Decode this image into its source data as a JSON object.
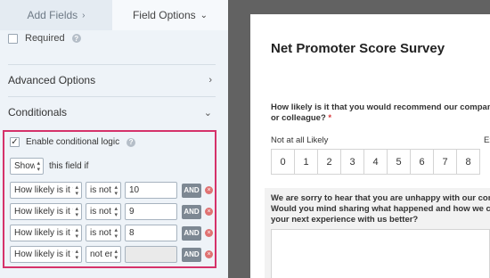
{
  "tabs": {
    "add_fields": "Add Fields",
    "add_fields_chevron": "›",
    "field_options": "Field Options",
    "field_options_chevron": "⌄"
  },
  "required": {
    "label": "Required",
    "checked": false,
    "help_icon": "question-icon"
  },
  "sections": {
    "advanced": {
      "label": "Advanced Options",
      "arrow": "›"
    },
    "conditionals": {
      "label": "Conditionals",
      "arrow": "⌄"
    }
  },
  "conditional": {
    "enable_label": "Enable conditional logic",
    "enabled": true,
    "checkmark": "✓",
    "action": "Show",
    "action_suffix": "this field if",
    "rules": [
      {
        "field": "How likely is it th",
        "operator": "is not",
        "value": "10",
        "and": "AND",
        "delete": "×"
      },
      {
        "field": "How likely is it th",
        "operator": "is not",
        "value": "9",
        "and": "AND",
        "delete": "×"
      },
      {
        "field": "How likely is it th",
        "operator": "is not",
        "value": "8",
        "and": "AND",
        "delete": "×"
      },
      {
        "field": "How likely is it th",
        "operator": "not em",
        "value": "",
        "and": "AND",
        "delete": "×"
      }
    ]
  },
  "preview": {
    "title": "Net Promoter Score Survey",
    "question1_line1": "How likely is it that you would recommend our company",
    "question1_line2": "or colleague?",
    "required_mark": "*",
    "scale_low": "Not at all Likely",
    "scale_high": "Ex",
    "scale": [
      "0",
      "1",
      "2",
      "3",
      "4",
      "5",
      "6",
      "7",
      "8"
    ],
    "question2_line1": "We are sorry to hear that you are unhappy with our com",
    "question2_line2": "Would you mind sharing what happened and how we co",
    "question2_line3": "your next experience with us better?"
  },
  "colors": {
    "highlight_border": "#d5326a",
    "left_panel_bg": "#eef3f8",
    "preview_backdrop": "#626262",
    "and_button": "#7d8893",
    "delete_icon": "#e07272"
  }
}
